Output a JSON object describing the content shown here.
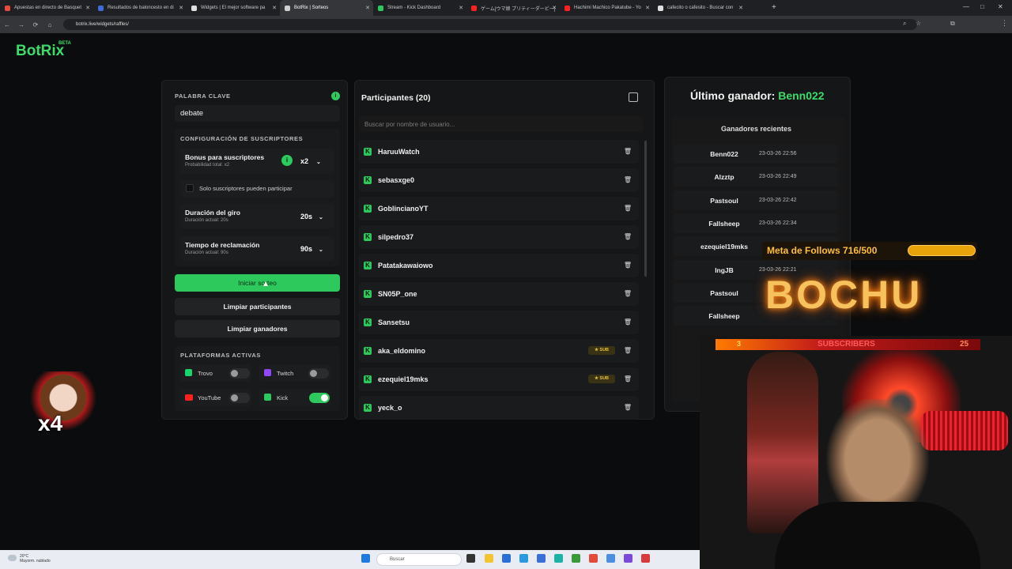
{
  "browser": {
    "tabs": [
      {
        "label": "Apuestas en directo de Basquet",
        "color": "#e84b3c"
      },
      {
        "label": "Resultados de baloncesto en di",
        "color": "#3f6bd8"
      },
      {
        "label": "Widgets | El mejor software pa",
        "color": "#e0e0e0"
      },
      {
        "label": "BotRix | Sorteos",
        "color": "#cfcfcf"
      },
      {
        "label": "Stream - Kick Dashboard",
        "color": "#2ec95c"
      },
      {
        "label": "ゲーム[ウマ娘 プリティーダービー]",
        "color": "#ff2020"
      },
      {
        "label": "Hachimi Machico Pakatube - Yo",
        "color": "#ff2020"
      },
      {
        "label": "cafecito o cafesito - Buscar con",
        "color": "#e0e0e0"
      }
    ],
    "url": "botrix.live/widgets/raffles/"
  },
  "app": {
    "logo": "BotRix",
    "beta": "BETA"
  },
  "settings": {
    "keyword_label": "PALABRA CLAVE",
    "keyword_value": "debate",
    "subs_config_label": "CONFIGURACIÓN DE SUSCRIPTORES",
    "bonus_title": "Bonus para suscriptores",
    "bonus_sub": "Probabilidad total: x2",
    "bonus_value": "x2",
    "only_subs_label": "Solo suscriptores pueden participar",
    "spin_title": "Duración del giro",
    "spin_sub": "Duración actual: 20s",
    "spin_value": "20s",
    "claim_title": "Tiempo de reclamación",
    "claim_sub": "Duración actual: 90s",
    "claim_value": "90s",
    "start_button": "Iniciar sorteo",
    "clear_participants": "Limpiar participantes",
    "clear_winners": "Limpiar ganadores",
    "platforms_label": "PLATAFORMAS ACTIVAS",
    "platforms": [
      {
        "name": "Trovo",
        "on": false
      },
      {
        "name": "Twitch",
        "on": false
      },
      {
        "name": "YouTube",
        "on": false
      },
      {
        "name": "Kick",
        "on": true
      }
    ]
  },
  "participants": {
    "title": "Participantes (20)",
    "search_placeholder": "Buscar por nombre de usuario...",
    "list": [
      {
        "name": "HaruuWatch",
        "sub": ""
      },
      {
        "name": "sebasxge0",
        "sub": ""
      },
      {
        "name": "GoblincianoYT",
        "sub": ""
      },
      {
        "name": "silpedro37",
        "sub": ""
      },
      {
        "name": "Patatakawaiowo",
        "sub": ""
      },
      {
        "name": "SN05P_one",
        "sub": ""
      },
      {
        "name": "Sansetsu",
        "sub": ""
      },
      {
        "name": "aka_eldomino",
        "sub": "★ SUB"
      },
      {
        "name": "ezequiel19mks",
        "sub": "★ SUB"
      },
      {
        "name": "yeck_o",
        "sub": ""
      }
    ]
  },
  "winners": {
    "last_label": "Último ganador:",
    "last_name": "Benn022",
    "recent_title": "Ganadores recientes",
    "list": [
      {
        "name": "Benn022",
        "date": "23-03-26 22:56"
      },
      {
        "name": "Alzztp",
        "date": "23-03-26 22:49"
      },
      {
        "name": "Pastsoul",
        "date": "23-03-26 22:42"
      },
      {
        "name": "Fallsheep",
        "date": "23-03-26 22:34"
      },
      {
        "name": "ezequiel19mks",
        "date": ""
      },
      {
        "name": "IngJB",
        "date": "23-03-26 22:21"
      },
      {
        "name": "Pastsoul",
        "date": ""
      },
      {
        "name": "Fallsheep",
        "date": ""
      }
    ]
  },
  "overlay": {
    "goal_text": "Meta de Follows 716/500",
    "brand": "BOCHU",
    "sub_count_left": "3",
    "sub_label": "SUBSCRIBERS",
    "sub_count_right": "25",
    "emote_text": "x4"
  },
  "taskbar": {
    "weather_temp": "20°C",
    "weather_desc": "Mayorm. nublado",
    "search": "Buscar"
  }
}
